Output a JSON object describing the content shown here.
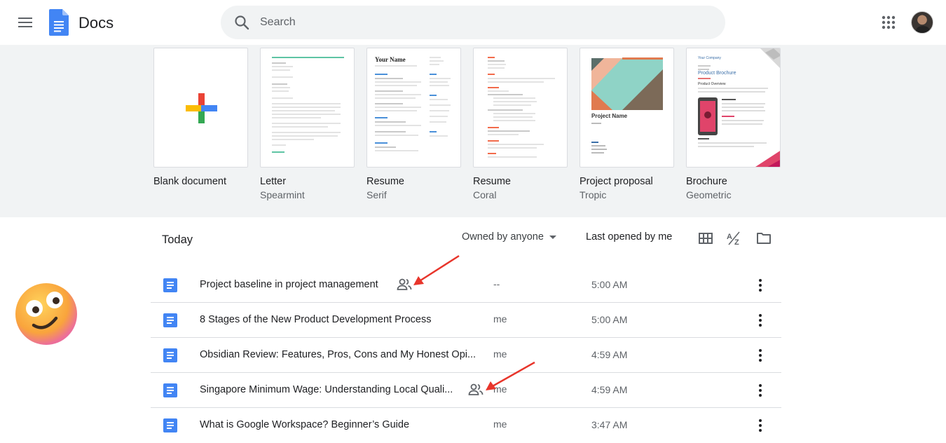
{
  "header": {
    "app_title": "Docs",
    "search_placeholder": "Search"
  },
  "templates": [
    {
      "title": "Blank document",
      "subtitle": ""
    },
    {
      "title": "Letter",
      "subtitle": "Spearmint"
    },
    {
      "title": "Resume",
      "subtitle": "Serif"
    },
    {
      "title": "Resume",
      "subtitle": "Coral"
    },
    {
      "title": "Project proposal",
      "subtitle": "Tropic"
    },
    {
      "title": "Brochure",
      "subtitle": "Geometric"
    }
  ],
  "thumb_text": {
    "resume_name": "Your Name",
    "project_name": "Project Name",
    "brochure_company": "Your Company",
    "brochure_title": "Product Brochure",
    "brochure_overview": "Product Overview"
  },
  "list": {
    "section_title": "Today",
    "owner_filter": "Owned by anyone",
    "sort_label": "Last opened by me",
    "rows": [
      {
        "name": "Project baseline in project management",
        "owner": "--",
        "time": "5:00 AM",
        "shared": true
      },
      {
        "name": "8 Stages of the New Product Development Process",
        "owner": "me",
        "time": "5:00 AM",
        "shared": false
      },
      {
        "name": "Obsidian Review: Features, Pros, Cons and My Honest Opi...",
        "owner": "me",
        "time": "4:59 AM",
        "shared": false
      },
      {
        "name": "Singapore Minimum Wage: Understanding Local Quali...",
        "owner": "me",
        "time": "4:59 AM",
        "shared": true
      },
      {
        "name": "What is Google Workspace? Beginner’s Guide",
        "owner": "me",
        "time": "3:47 AM",
        "shared": false
      }
    ]
  },
  "colors": {
    "docs_blue": "#4285f4",
    "annotation_red": "#e8352b",
    "band_gray": "#f1f3f4"
  },
  "icons": [
    "menu-icon",
    "docs-logo-icon",
    "search-icon",
    "apps-grid-icon",
    "grid-view-icon",
    "sort-az-icon",
    "folder-icon",
    "doc-icon",
    "shared-people-icon",
    "more-vert-icon"
  ]
}
